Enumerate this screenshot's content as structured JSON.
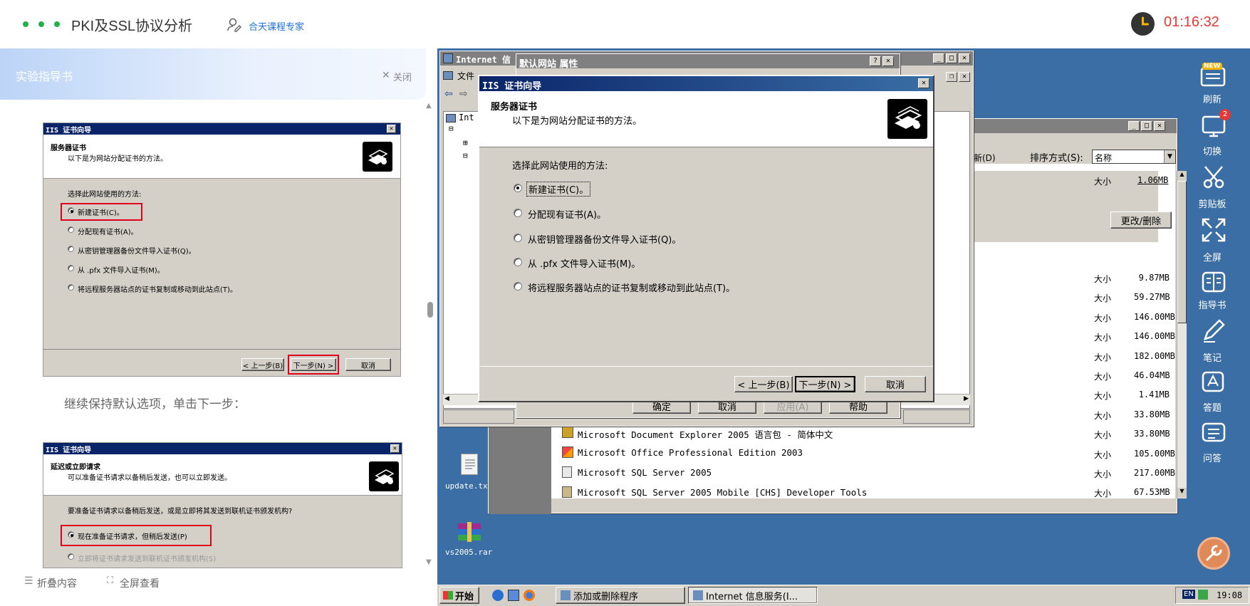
{
  "header": {
    "title": "PKI及SSL协议分析",
    "expert_label": "合天课程专家",
    "timer": "01:16:32"
  },
  "guide": {
    "title": "实验指导书",
    "close_label": "关闭",
    "step_text": "继续保持默认选项，单击下一步：",
    "fold_label": "折叠内容",
    "fullscreen_label": "全屏查看",
    "shot1": {
      "title": "IIS 证书向导",
      "heading": "服务器证书",
      "subheading": "以下是为网站分配证书的方法。",
      "prompt": "选择此网站使用的方法:",
      "options": [
        "新建证书(C)。",
        "分配现有证书(A)。",
        "从密钥管理器备份文件导入证书(Q)。",
        "从 .pfx 文件导入证书(M)。",
        "将远程服务器站点的证书复制或移动到此站点(T)。"
      ],
      "back": "< 上一步(B)",
      "next": "下一步(N) >",
      "cancel": "取消"
    },
    "shot2": {
      "title": "IIS 证书向导",
      "heading": "延迟或立即请求",
      "subheading": "可以准备证书请求以备稍后发送，也可以立即发送。",
      "prompt": "要准备证书请求以备稍后发送，或是立即将其发送到联机证书颁发机构?",
      "options": [
        "现在准备证书请求，但稍后发送(P)",
        "立即将证书请求发送到联机证书颁发机构(S)"
      ]
    }
  },
  "remote": {
    "iis_window_title": "Internet 信",
    "iis_menu_file": "文件",
    "iis_tree_root": "Int",
    "props_title": "默认网站 属性",
    "props_buttons": [
      "确定",
      "取消",
      "应用(A)",
      "帮助"
    ],
    "wizard": {
      "title": "IIS 证书向导",
      "heading": "服务器证书",
      "subheading": "以下是为网站分配证书的方法。",
      "prompt": "选择此网站使用的方法:",
      "options": [
        "新建证书(C)。",
        "分配现有证书(A)。",
        "从密钥管理器备份文件导入证书(Q)。",
        "从 .pfx 文件导入证书(M)。",
        "将远程服务器站点的证书复制或移动到此站点(T)。"
      ],
      "back": "< 上一步(B)",
      "next": "下一步(N) >",
      "cancel": "取消"
    },
    "arp": {
      "partial_new": "新(D)",
      "sort_label": "排序方式(S):",
      "sort_value": "名称",
      "size_label": "大小",
      "first_size": "1.06MB",
      "change_remove": "更改/删除",
      "sizes": [
        "9.87MB",
        "59.27MB",
        "146.00MB",
        "146.00MB",
        "182.00MB",
        "46.04MB",
        "1.41MB",
        "33.80MB",
        "33.80MB",
        "105.00MB",
        "217.00MB",
        "67.53MB"
      ],
      "programs": [
        "Microsoft Document Explorer 2005 语言包 - 简体中文",
        "Microsoft Office Professional Edition 2003",
        "Microsoft SQL Server 2005",
        "Microsoft SQL Server 2005 Mobile [CHS] Developer Tools"
      ]
    },
    "desktop_icons": [
      "update.tx",
      "vs2005.rar"
    ],
    "taskbar": {
      "start": "开始",
      "tasks": [
        "添加或删除程序",
        "Internet 信息服务(I..."
      ],
      "lang": "EN",
      "clock": "19:08"
    }
  },
  "sidebar": {
    "items": [
      "刷新",
      "切换",
      "剪贴板",
      "全屏",
      "指导书",
      "笔记",
      "答题",
      "问答"
    ],
    "new_badge": "NEW",
    "switch_badge": "2"
  },
  "colors": {
    "accent": "#1e6fd9",
    "timer_red": "#e53935",
    "desktop_blue": "#3a6ea5",
    "xp_gray": "#d4d0c8",
    "title_navy": "#0a246a",
    "highlight_red": "#e0001b"
  }
}
